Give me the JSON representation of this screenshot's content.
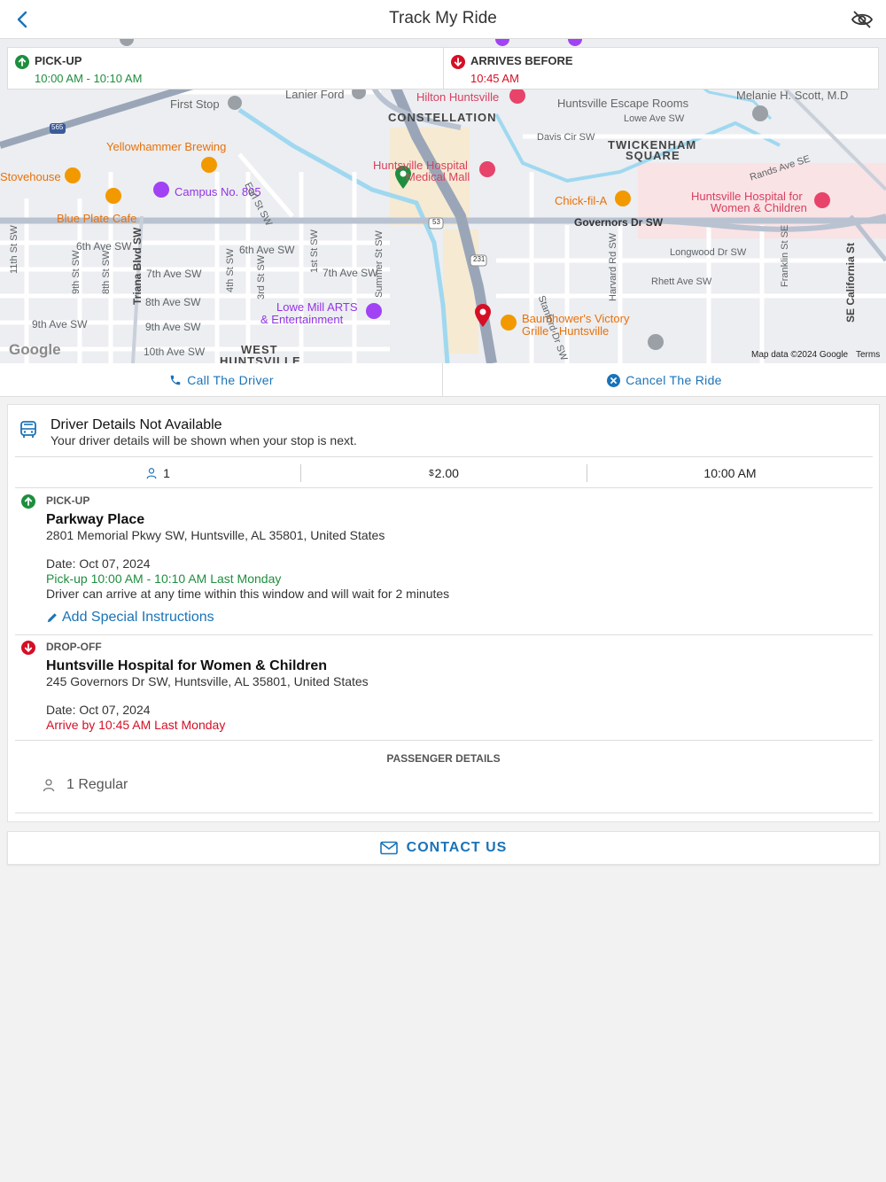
{
  "header": {
    "title": "Track My Ride"
  },
  "times": {
    "pickup_label": "PICK-UP",
    "pickup_value": "10:00 AM - 10:10 AM",
    "arrive_label": "ARRIVES BEFORE",
    "arrive_value": "10:45 AM"
  },
  "map": {
    "labels": {
      "constellation": "CONSTELLATION",
      "twickenham": "TWICKENHAM",
      "square": "SQUARE",
      "west": "WEST",
      "huntsville": "HUNTSVILLE",
      "lanier": "Lanier Ford",
      "first_stop": "First Stop",
      "yellowhammer": "Yellowhammer Brewing",
      "stovehouse": "Stovehouse",
      "campus": "Campus No. 805",
      "blueplate": "Blue Plate Cafe",
      "hilton": "Hilton Huntsville",
      "hh_medical1": "Huntsville Hospital",
      "hh_medical2": "Medical Mall",
      "escape": "Huntsville Escape Rooms",
      "melanie": "Melanie H. Scott, M.D",
      "chickfila": "Chick-fil-A",
      "hh_women1": "Huntsville Hospital for",
      "hh_women2": "Women & Children",
      "governors": "Governors Dr SW",
      "lowe1": "Lowe Mill ARTS",
      "lowe2": "& Entertainment",
      "baum1": "Baumhower's Victory",
      "baum2": "Grille - Huntsville",
      "sixth_ave": "6th Ave SW",
      "sixth_ave2": "6th Ave SW",
      "seventh_ave": "7th Ave SW",
      "seventh_ave2": "7th Ave SW",
      "eighth_ave": "8th Ave SW",
      "ninth_ave": "9th Ave SW",
      "ninth_ave2": "9th Ave SW",
      "tenth_ave": "10th Ave SW",
      "davis": "Davis Cir SW",
      "lowe_ave": "Lowe Ave SW",
      "rands": "Rands Ave SE",
      "longwood": "Longwood Dr SW",
      "rhett": "Rhett Ave SW",
      "triana": "Triana Blvd SW",
      "eleventh_st": "11th St SW",
      "ninth_st": "9th St SW",
      "eighth_st": "8th St SW",
      "fourth_st": "4th St SW",
      "third_st": "3rd St SW",
      "first_st": "1st St SW",
      "summer": "Summer St SW",
      "earl": "Earl St SW",
      "stanford": "Stanford Dr SW",
      "harvard": "Harvard Rd SW",
      "franklin": "Franklin St SE",
      "california": "SE California St",
      "r53": "53",
      "r231": "231",
      "r565": "565",
      "google": "Google",
      "mapdata": "Map data ©2024 Google",
      "terms": "Terms"
    }
  },
  "actions": {
    "call": "Call The Driver",
    "cancel": "Cancel The Ride"
  },
  "driver": {
    "title": "Driver Details Not Available",
    "subtitle": "Your driver details will be shown when your stop is next."
  },
  "stats": {
    "passengers": "1",
    "currency": "$",
    "fare": "2.00",
    "time": "10:00 AM"
  },
  "pickup": {
    "label": "PICK-UP",
    "place": "Parkway Place",
    "address": "2801 Memorial Pkwy SW, Huntsville, AL 35801, United States",
    "date": "Date: Oct 07, 2024",
    "window": "Pick-up 10:00 AM - 10:10 AM Last Monday",
    "note": "Driver can arrive at any time within this window and will wait for 2 minutes",
    "add_instructions": "Add Special Instructions"
  },
  "dropoff": {
    "label": "DROP-OFF",
    "place": "Huntsville Hospital for Women & Children",
    "address": "245 Governors Dr SW, Huntsville, AL 35801, United States",
    "date": "Date: Oct 07, 2024",
    "arrive": "Arrive by 10:45 AM Last Monday"
  },
  "passengers": {
    "title": "PASSENGER DETAILS",
    "item": "1 Regular"
  },
  "contact": {
    "label": "CONTACT US"
  },
  "colors": {
    "accent": "#1a73b8",
    "green": "#1e8e3e",
    "red": "#d50f25"
  }
}
